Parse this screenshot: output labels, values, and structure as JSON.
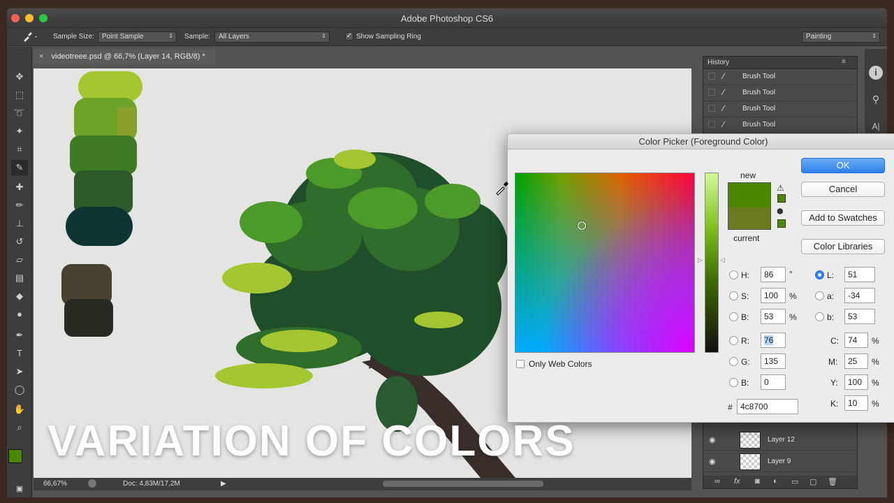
{
  "window": {
    "title": "Adobe Photoshop CS6"
  },
  "options_bar": {
    "sample_size_label": "Sample Size:",
    "sample_size_value": "Point Sample",
    "sample_label": "Sample:",
    "sample_value": "All Layers",
    "show_ring_label": "Show Sampling Ring",
    "show_ring_checked": true,
    "workspace_value": "Painting"
  },
  "document": {
    "tab_title": "videotreee.psd @ 66,7% (Layer 14, RGB/8) *",
    "tab_close": "×"
  },
  "status_bar": {
    "zoom": "66,67%",
    "doc_info": "Doc: 4,83M/17,2M"
  },
  "history": {
    "title": "History",
    "items": [
      {
        "label": "Brush Tool"
      },
      {
        "label": "Brush Tool"
      },
      {
        "label": "Brush Tool"
      },
      {
        "label": "Brush Tool"
      }
    ]
  },
  "layers": {
    "items": [
      {
        "label": "Layer 12"
      },
      {
        "label": "Layer 9"
      }
    ]
  },
  "color_picker": {
    "title": "Color Picker (Foreground Color)",
    "new_label": "new",
    "current_label": "current",
    "new_color": "#4c8700",
    "current_color": "#6b7a1e",
    "ok_label": "OK",
    "cancel_label": "Cancel",
    "add_swatches_label": "Add to Swatches",
    "libraries_label": "Color Libraries",
    "only_web_label": "Only Web Colors",
    "fields": {
      "H": {
        "label": "H:",
        "value": "86",
        "unit": "°"
      },
      "S": {
        "label": "S:",
        "value": "100",
        "unit": "%"
      },
      "Bv": {
        "label": "B:",
        "value": "53",
        "unit": "%"
      },
      "R": {
        "label": "R:",
        "value": "76"
      },
      "G": {
        "label": "G:",
        "value": "135"
      },
      "Bc": {
        "label": "B:",
        "value": "0"
      },
      "L": {
        "label": "L:",
        "value": "51"
      },
      "a": {
        "label": "a:",
        "value": "-34"
      },
      "b": {
        "label": "b:",
        "value": "53"
      },
      "C": {
        "label": "C:",
        "value": "74",
        "unit": "%"
      },
      "M": {
        "label": "M:",
        "value": "25",
        "unit": "%"
      },
      "Y": {
        "label": "Y:",
        "value": "100",
        "unit": "%"
      },
      "K": {
        "label": "K:",
        "value": "10",
        "unit": "%"
      }
    },
    "hex_label": "#",
    "hex_value": "4c8700"
  },
  "overlay": {
    "caption": "VARIATION OF COLORS"
  },
  "colors": {
    "foreground_swatch": "#4c8700",
    "accent": "#2d7fe8"
  }
}
